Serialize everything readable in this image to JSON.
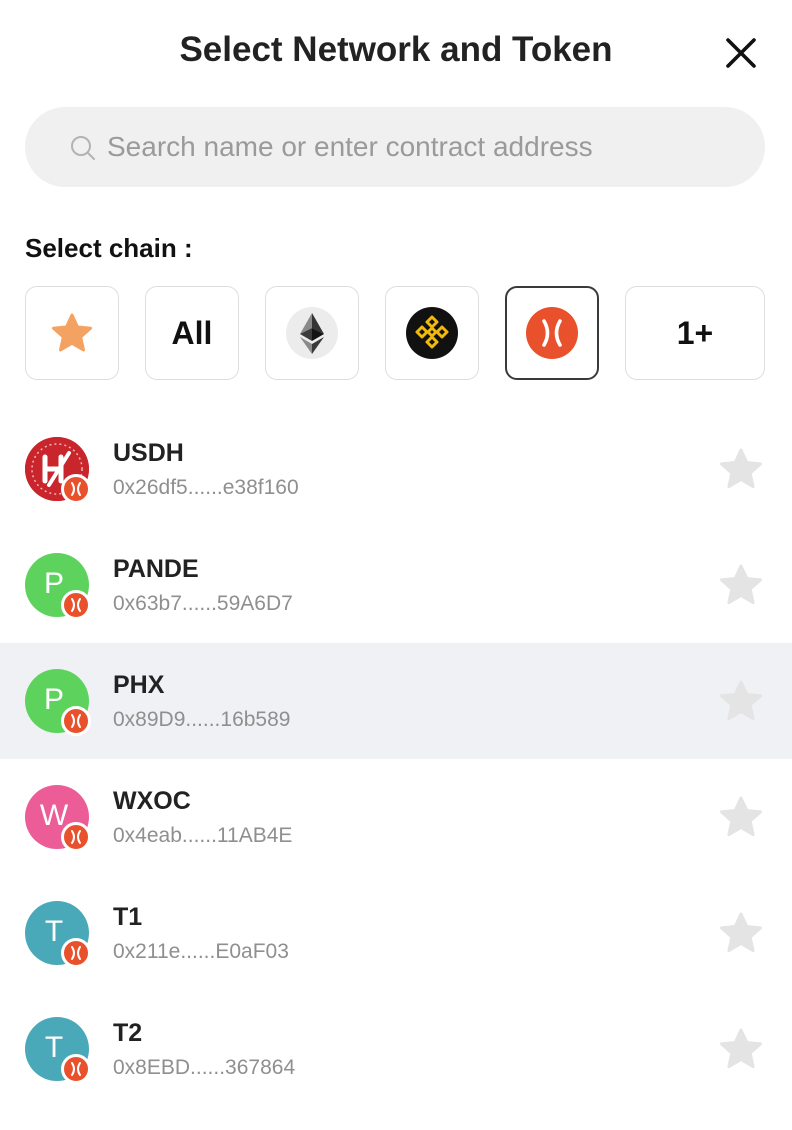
{
  "modal": {
    "title": "Select Network and Token"
  },
  "search": {
    "placeholder": "Search name or enter contract address",
    "value": ""
  },
  "chains": {
    "label": "Select chain :",
    "buttons": [
      {
        "id": "favorites",
        "icon": "star-icon",
        "label": "",
        "selected": false
      },
      {
        "id": "all",
        "label": "All",
        "selected": false
      },
      {
        "id": "ethereum",
        "icon": "ethereum-icon",
        "label": "",
        "selected": false
      },
      {
        "id": "bnb",
        "icon": "bnb-chain-icon",
        "label": "",
        "selected": false
      },
      {
        "id": "network",
        "icon": "network-logo-icon",
        "label": "",
        "selected": true
      },
      {
        "id": "more",
        "label": "1+",
        "selected": false
      }
    ]
  },
  "tokens": [
    {
      "symbol": "USDH",
      "address": "0x26df5......e38f160",
      "avatar_letter": "",
      "avatar_color": "#cc2a2a",
      "hovered": false
    },
    {
      "symbol": "PANDE",
      "address": "0x63b7......59A6D7",
      "avatar_letter": "P",
      "avatar_color": "#5dd35d",
      "hovered": false
    },
    {
      "symbol": "PHX",
      "address": "0x89D9......16b589",
      "avatar_letter": "P",
      "avatar_color": "#5dd35d",
      "hovered": true
    },
    {
      "symbol": "WXOC",
      "address": "0x4eab......11AB4E",
      "avatar_letter": "W",
      "avatar_color": "#ec5d98",
      "hovered": false
    },
    {
      "symbol": "T1",
      "address": "0x211e......E0aF03",
      "avatar_letter": "T",
      "avatar_color": "#4aa9b8",
      "hovered": false
    },
    {
      "symbol": "T2",
      "address": "0x8EBD......367864",
      "avatar_letter": "T",
      "avatar_color": "#4aa9b8",
      "hovered": false
    }
  ],
  "colors": {
    "accent": "#e8512c",
    "star_fav": "#f4a261",
    "star_inactive": "#e4e4e4"
  }
}
